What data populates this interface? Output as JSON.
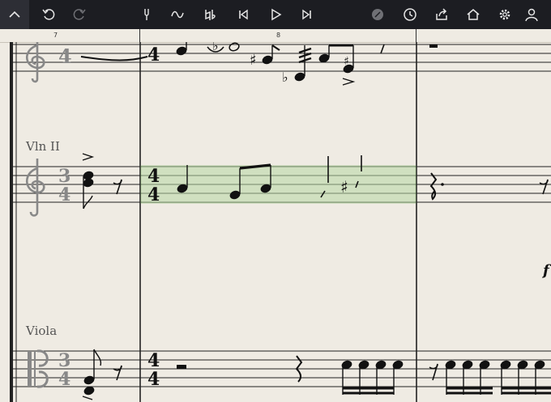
{
  "toolbar": {
    "buttons": [
      {
        "id": "collapse",
        "icon": "chevron-up-icon"
      },
      {
        "id": "undo",
        "icon": "undo-icon"
      },
      {
        "id": "redo",
        "icon": "redo-icon"
      },
      {
        "id": "metronome",
        "icon": "tuning-fork-icon"
      },
      {
        "id": "slur",
        "icon": "slur-icon"
      },
      {
        "id": "natural",
        "icon": "natural-flat-icon"
      },
      {
        "id": "rewind",
        "icon": "skip-back-icon"
      },
      {
        "id": "play",
        "icon": "play-icon"
      },
      {
        "id": "forward",
        "icon": "skip-forward-icon"
      },
      {
        "id": "disc",
        "icon": "disc-icon"
      },
      {
        "id": "history",
        "icon": "clock-icon"
      },
      {
        "id": "share",
        "icon": "share-icon"
      },
      {
        "id": "home",
        "icon": "home-icon"
      },
      {
        "id": "settings",
        "icon": "gear-icon"
      },
      {
        "id": "account",
        "icon": "user-icon"
      }
    ]
  },
  "ruler": {
    "measure_numbers": [
      "7",
      "8"
    ]
  },
  "score": {
    "instruments": [
      {
        "name": "Vln II",
        "clef": "treble"
      },
      {
        "name": "Viola",
        "clef": "alto"
      }
    ],
    "top_staff_time_sig": [
      "4",
      "4"
    ],
    "vln2_time_sig_old": [
      "3",
      "4"
    ],
    "vln2_time_sig_new": [
      "4",
      "4"
    ],
    "viola_time_sig_old": [
      "3",
      "4"
    ],
    "viola_time_sig_new": [
      "4",
      "4"
    ],
    "dynamic_mark": "f",
    "colors": {
      "selection": "#b8d8a5",
      "toolbar_bg": "#1c1d22",
      "paper": "#efebe3"
    }
  }
}
